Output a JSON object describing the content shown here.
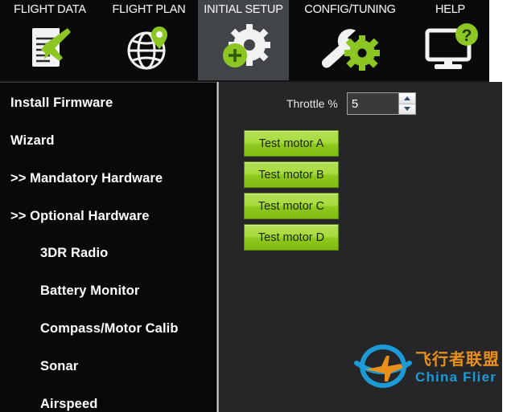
{
  "header": {
    "tabs": [
      {
        "label": "FLIGHT DATA",
        "icon": "flight-data-icon",
        "active": false
      },
      {
        "label": "FLIGHT PLAN",
        "icon": "flight-plan-icon",
        "active": false
      },
      {
        "label": "INITIAL SETUP",
        "icon": "initial-setup-icon",
        "active": true
      },
      {
        "label": "CONFIG/TUNING",
        "icon": "config-tuning-icon",
        "active": false
      },
      {
        "label": "HELP",
        "icon": "help-icon",
        "active": false
      }
    ]
  },
  "sidebar": {
    "items": [
      {
        "label": "Install Firmware",
        "level": 0
      },
      {
        "label": "Wizard",
        "level": 0
      },
      {
        "label": ">> Mandatory Hardware",
        "level": 0
      },
      {
        "label": ">> Optional Hardware",
        "level": 0
      },
      {
        "label": "3DR Radio",
        "level": 1
      },
      {
        "label": "Battery Monitor",
        "level": 1
      },
      {
        "label": "Compass/Motor Calib",
        "level": 1
      },
      {
        "label": "Sonar",
        "level": 1
      },
      {
        "label": "Airspeed",
        "level": 1
      }
    ]
  },
  "content": {
    "throttle": {
      "label": "Throttle %",
      "value": "5",
      "placeholder": "0"
    },
    "motor_buttons": [
      {
        "label": "Test motor A"
      },
      {
        "label": "Test motor B"
      },
      {
        "label": "Test motor C"
      },
      {
        "label": "Test motor D"
      }
    ]
  },
  "watermark": {
    "chinese": "飞行者联盟",
    "english": "China Flier"
  },
  "colors": {
    "header_bg": "#0a0a0a",
    "active_tab_bg": "#414448",
    "sidebar_bg": "#090909",
    "panel_bg": "#262628",
    "accent_green": "#8fc91f",
    "watermark_orange": "#e8901c",
    "watermark_blue": "#1b9ad6"
  }
}
